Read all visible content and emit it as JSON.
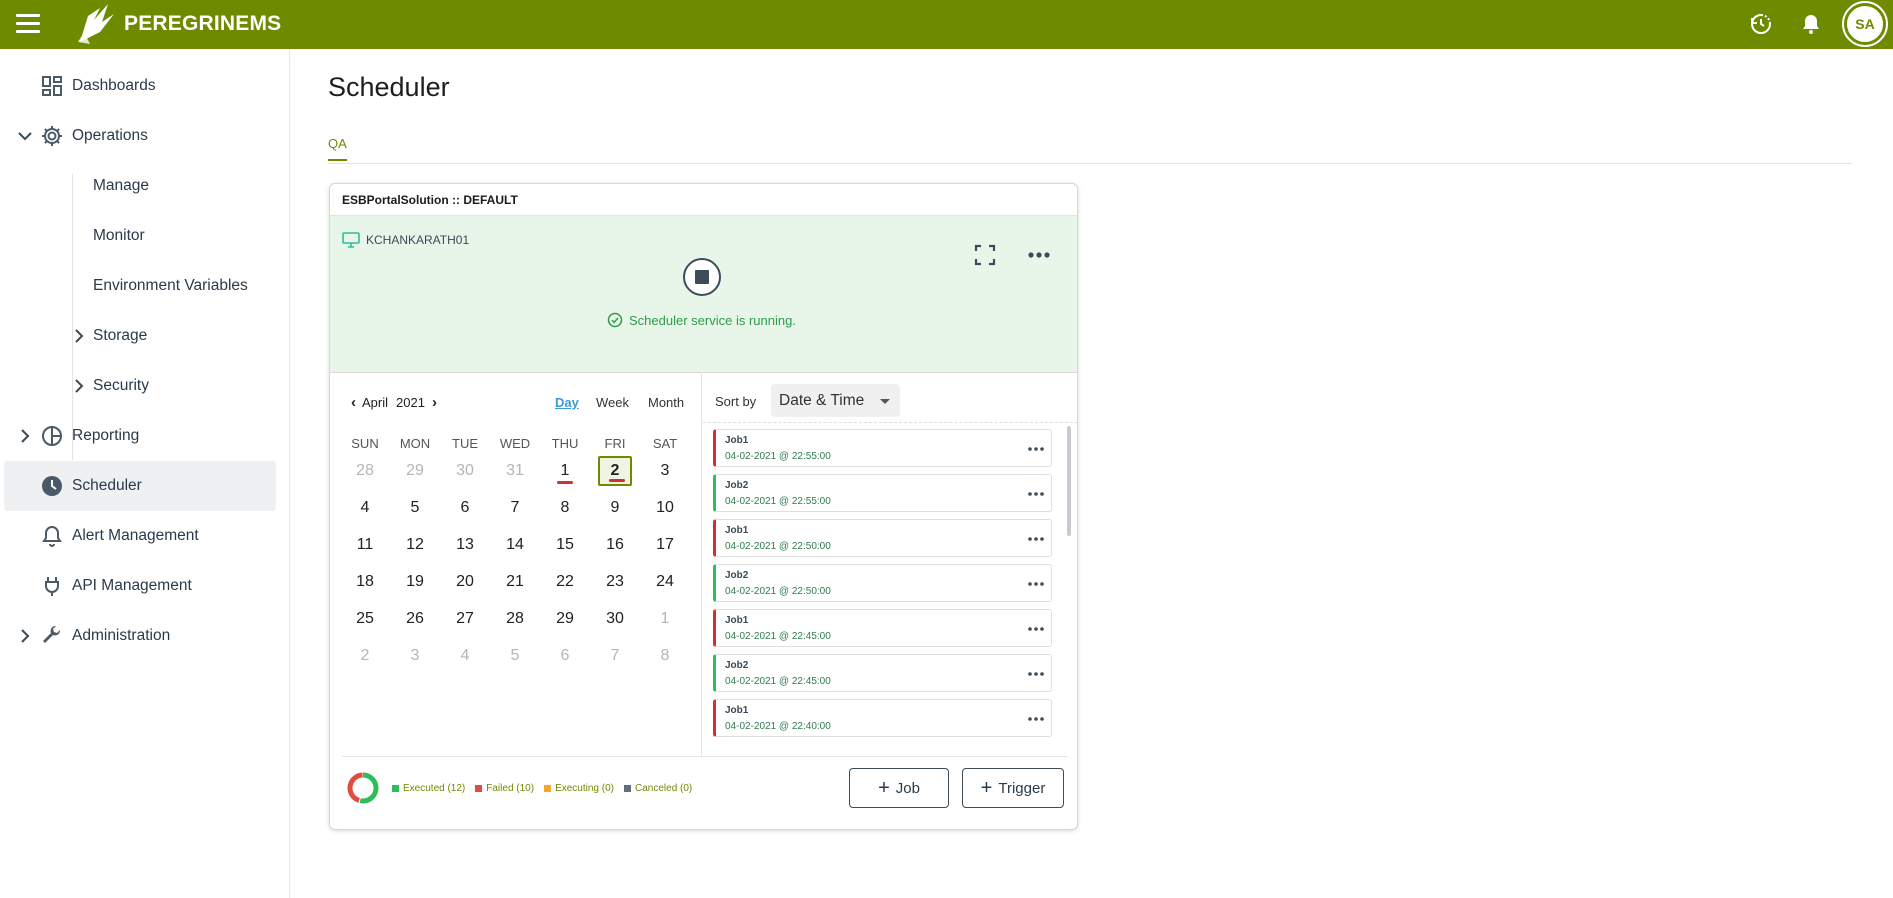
{
  "brand": {
    "name": "PEREGRINEMS",
    "color": "#6e8b00"
  },
  "header": {
    "menu_icon": "hamburger-icon",
    "history_icon": "history-icon",
    "bell_icon": "bell-icon",
    "avatar_initials": "SA"
  },
  "sidebar": {
    "items": [
      {
        "label": "Dashboards",
        "icon": "dashboard-icon"
      },
      {
        "label": "Operations",
        "icon": "gear-icon",
        "expanded": true
      },
      {
        "label": "Manage"
      },
      {
        "label": "Monitor"
      },
      {
        "label": "Environment Variables"
      },
      {
        "label": "Storage",
        "collapsed": true
      },
      {
        "label": "Security",
        "collapsed": true
      },
      {
        "label": "Reporting",
        "icon": "pie-icon"
      },
      {
        "label": "Scheduler",
        "icon": "clock-icon",
        "active": true
      },
      {
        "label": "Alert Management",
        "icon": "bell-icon"
      },
      {
        "label": "API Management",
        "icon": "plug-icon"
      },
      {
        "label": "Administration",
        "icon": "wrench-icon"
      }
    ]
  },
  "page": {
    "title": "Scheduler",
    "tabs": [
      "QA"
    ]
  },
  "card": {
    "title": "ESBPortalSolution :: DEFAULT",
    "host": "KCHANKARATH01",
    "status": "Scheduler service is running."
  },
  "calendar": {
    "month": "April",
    "year": "2021",
    "views": {
      "day": "Day",
      "week": "Week",
      "month": "Month"
    },
    "active_view": "Day",
    "weekdays": [
      "SUN",
      "MON",
      "TUE",
      "WED",
      "THU",
      "FRI",
      "SAT"
    ],
    "weeks": [
      [
        "28",
        "29",
        "30",
        "31",
        "1",
        "2",
        "3"
      ],
      [
        "4",
        "5",
        "6",
        "7",
        "8",
        "9",
        "10"
      ],
      [
        "11",
        "12",
        "13",
        "14",
        "15",
        "16",
        "17"
      ],
      [
        "18",
        "19",
        "20",
        "21",
        "22",
        "23",
        "24"
      ],
      [
        "25",
        "26",
        "27",
        "28",
        "29",
        "30",
        "1"
      ],
      [
        "2",
        "3",
        "4",
        "5",
        "6",
        "7",
        "8"
      ]
    ],
    "selected_day": "2",
    "marked_days": [
      "1",
      "2"
    ]
  },
  "jobs": {
    "sort_label": "Sort by",
    "sort_value": "Date & Time",
    "items": [
      {
        "name": "Job1",
        "time": "04-02-2021 @ 22:55:00",
        "status": "failed"
      },
      {
        "name": "Job2",
        "time": "04-02-2021 @ 22:55:00",
        "status": "executed"
      },
      {
        "name": "Job1",
        "time": "04-02-2021 @ 22:50:00",
        "status": "failed"
      },
      {
        "name": "Job2",
        "time": "04-02-2021 @ 22:50:00",
        "status": "executed"
      },
      {
        "name": "Job1",
        "time": "04-02-2021 @ 22:45:00",
        "status": "failed"
      },
      {
        "name": "Job2",
        "time": "04-02-2021 @ 22:45:00",
        "status": "executed"
      },
      {
        "name": "Job1",
        "time": "04-02-2021 @ 22:40:00",
        "status": "failed"
      }
    ]
  },
  "summary": {
    "legend": [
      {
        "label": "Executed (12)",
        "color": "#2ebd59"
      },
      {
        "label": "Failed (10)",
        "color": "#e24c3e"
      },
      {
        "label": "Executing (0)",
        "color": "#f5a623"
      },
      {
        "label": "Canceled (0)",
        "color": "#5c6f80"
      }
    ],
    "counts": {
      "executed": 12,
      "failed": 10,
      "executing": 0,
      "canceled": 0
    },
    "add_job": "Job",
    "add_trigger": "Trigger"
  }
}
